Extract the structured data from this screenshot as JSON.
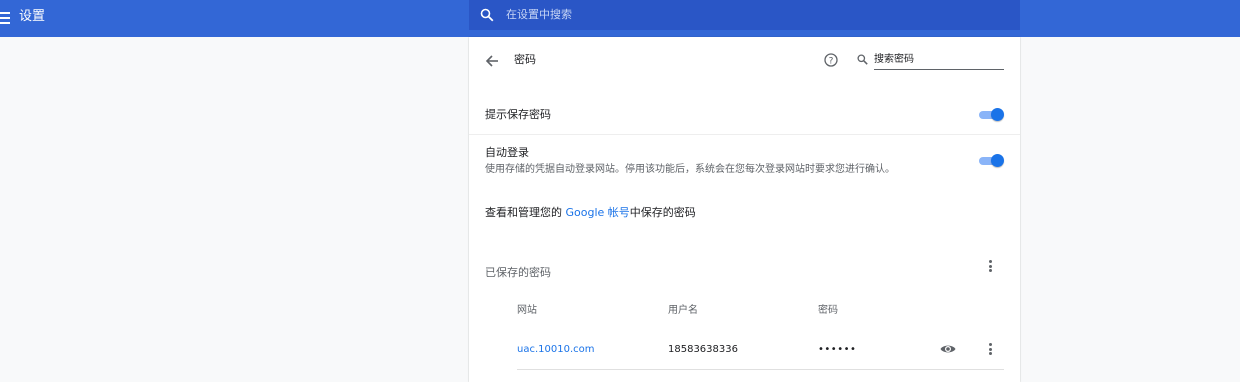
{
  "header": {
    "title": "设置",
    "search_placeholder": "在设置中搜索",
    "menu_icon": "hamburger-menu-icon",
    "search_icon": "search-icon"
  },
  "page": {
    "title": "密码",
    "search_passwords_placeholder": "搜索密码"
  },
  "settings": {
    "offer_to_save": {
      "label": "提示保存密码",
      "enabled": true
    },
    "auto_signin": {
      "label": "自动登录",
      "description": "使用存储的凭据自动登录网站。停用该功能后，系统会在您每次登录网站时要求您进行确认。",
      "enabled": true
    }
  },
  "google_account": {
    "prefix": "查看和管理您的 ",
    "link": "Google 帐号",
    "suffix": "中保存的密码"
  },
  "saved_passwords": {
    "title": "已保存的密码",
    "columns": [
      "网站",
      "用户名",
      "密码"
    ],
    "rows": [
      {
        "site": "uac.10010.com",
        "username": "18583638336",
        "password": "••••••"
      }
    ]
  },
  "colors": {
    "header_bg": "#3367d6",
    "search_bg": "#2a56c6",
    "accent": "#1a73e8"
  }
}
